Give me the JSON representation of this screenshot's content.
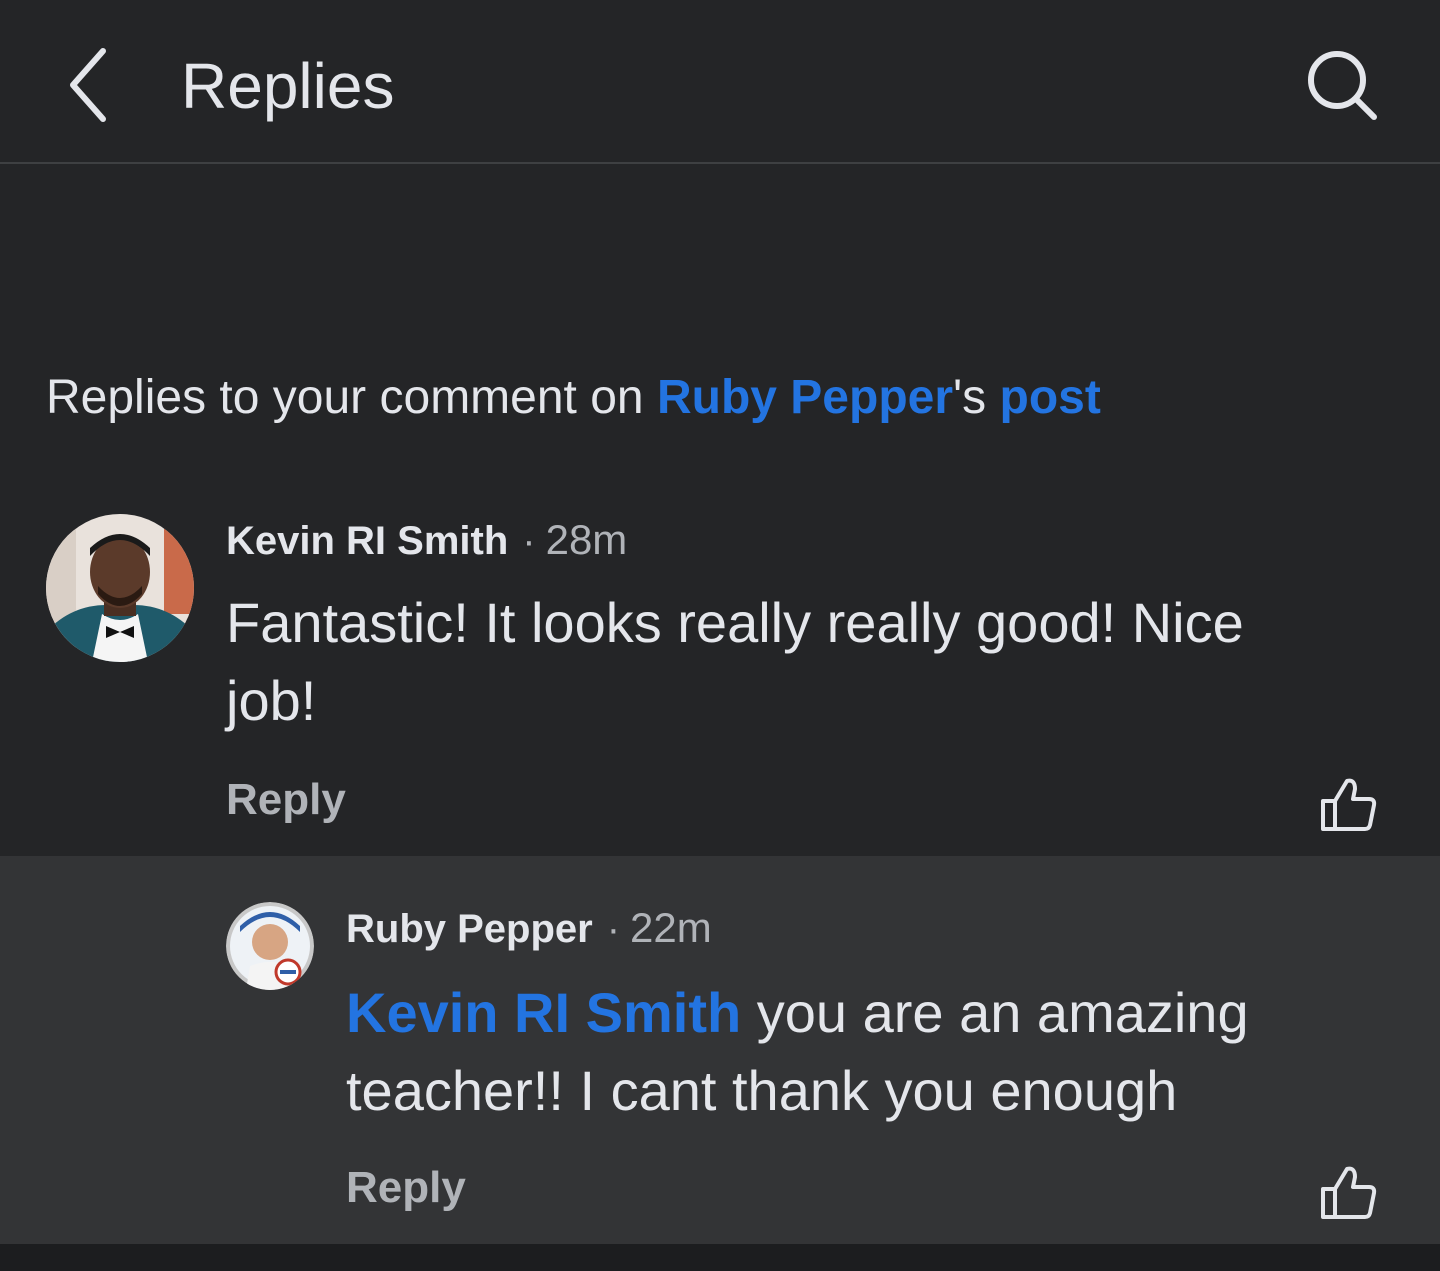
{
  "header": {
    "title": "Replies",
    "back_icon": "chevron-left-icon",
    "search_icon": "search-icon"
  },
  "context": {
    "prefix": "Replies to your comment on ",
    "author_link": "Ruby Pepper",
    "possessive": "'s ",
    "post_link": "post"
  },
  "comments": [
    {
      "author": "Kevin RI Smith",
      "separator": "·",
      "time": "28m",
      "text": "Fantastic! It looks really really good! Nice job!",
      "reply_label": "Reply",
      "like_icon": "thumbs-up-icon"
    },
    {
      "author": "Ruby Pepper",
      "separator": "·",
      "time": "22m",
      "mention": "Kevin RI Smith",
      "text": " you are an amazing teacher!! I cant thank you enough",
      "reply_label": "Reply",
      "like_icon": "thumbs-up-icon"
    }
  ],
  "colors": {
    "background": "#242527",
    "reply_highlight": "#333436",
    "link": "#2374e1",
    "text": "#e4e6eb",
    "secondary_text": "#b0b3b8"
  }
}
